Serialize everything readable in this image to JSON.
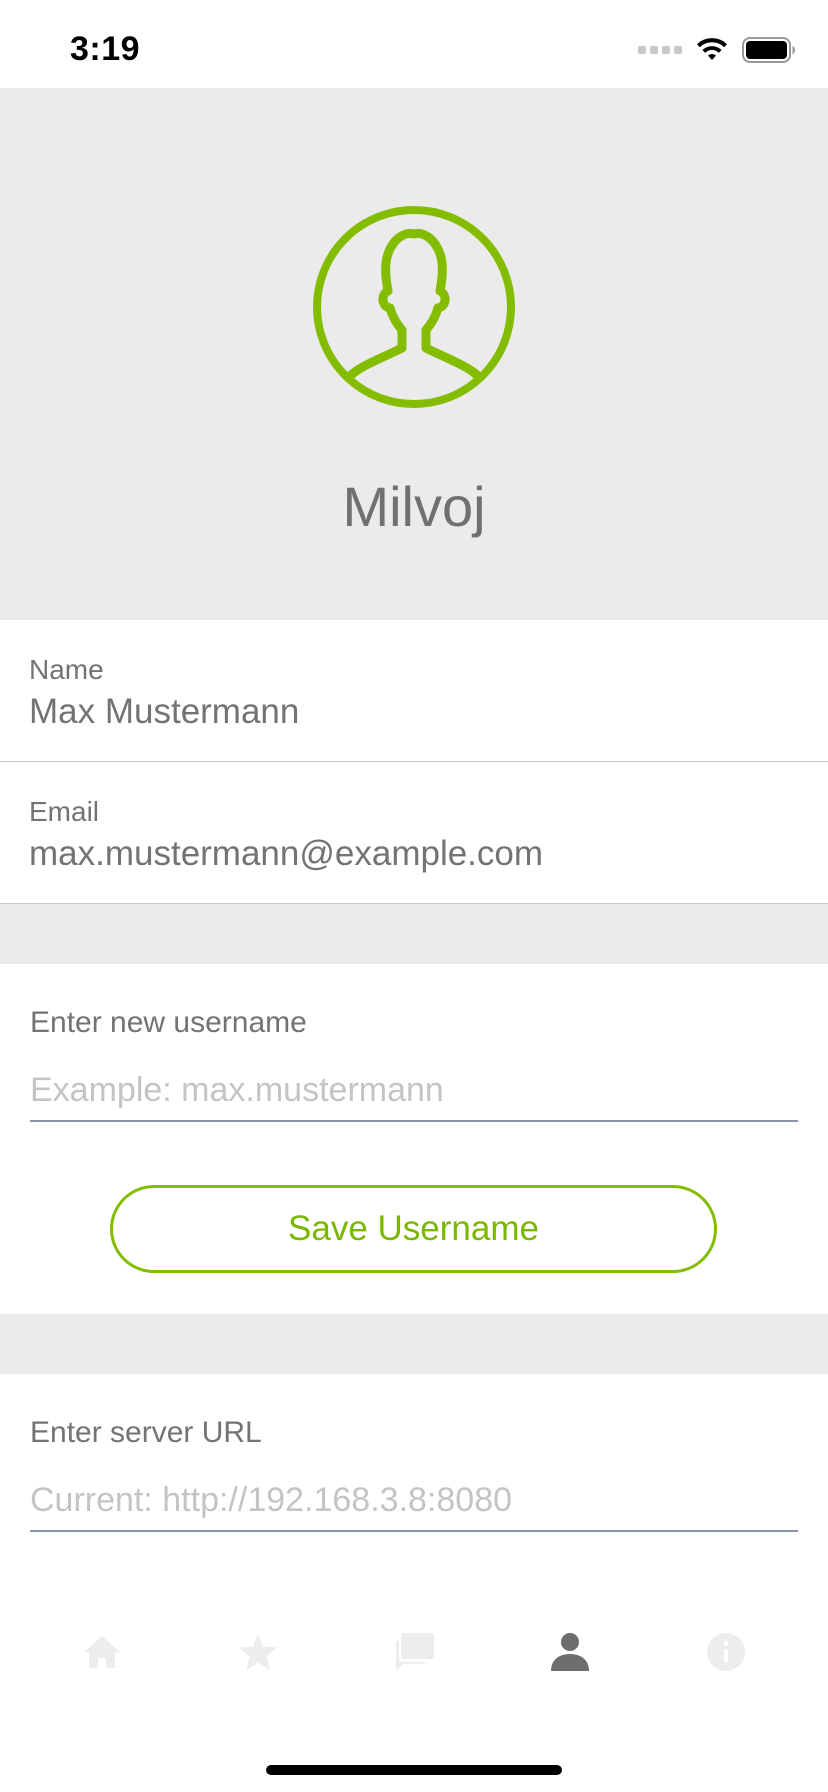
{
  "status_bar": {
    "time": "3:19"
  },
  "profile": {
    "display_name": "Milvoj",
    "accent_color": "#84bd00",
    "avatar_icon": "user-circle-icon"
  },
  "info": {
    "name_label": "Name",
    "name_value": "Max Mustermann",
    "email_label": "Email",
    "email_value": "max.mustermann@example.com"
  },
  "username_form": {
    "label": "Enter new username",
    "placeholder": "Example: max.mustermann",
    "value": "",
    "save_label": "Save Username"
  },
  "server_form": {
    "label": "Enter server URL",
    "placeholder": "Current: http://192.168.3.8:8080",
    "value": ""
  },
  "tab_bar": {
    "tabs": [
      {
        "icon": "home-icon",
        "active": false
      },
      {
        "icon": "star-icon",
        "active": false
      },
      {
        "icon": "chat-icon",
        "active": false
      },
      {
        "icon": "person-icon",
        "active": true
      },
      {
        "icon": "info-icon",
        "active": false
      }
    ]
  }
}
